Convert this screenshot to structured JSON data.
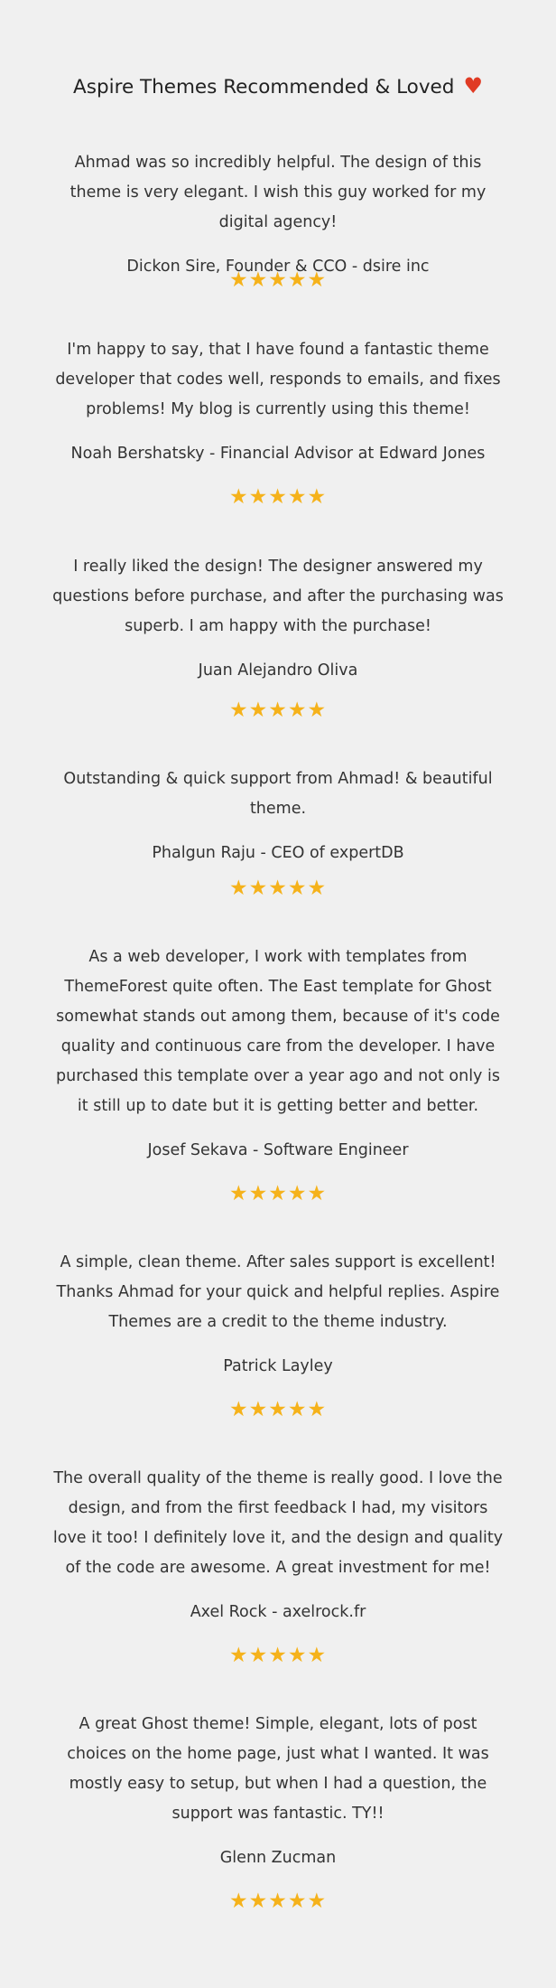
{
  "heading": {
    "title": "Aspire Themes Recommended & Loved",
    "heart_icon": "♥"
  },
  "colors": {
    "background": "#f0f0f0",
    "text": "#333333",
    "heart": "#e03b24",
    "star": "#f5b21b"
  },
  "star_icon": "★",
  "reviews": [
    {
      "quote": "Ahmad was so incredibly helpful. The design of this theme is very elegant. I wish this guy worked for my digital agency!",
      "author": "Dickon Sire, Founder & CCO - dsire inc",
      "rating": 5
    },
    {
      "quote": "I'm happy to say, that I have found a fantastic theme developer that codes well, responds to emails, and fixes problems! My blog is currently using this theme!",
      "author": "Noah Bershatsky - Financial Advisor at Edward Jones",
      "rating": 5
    },
    {
      "quote": "I really liked the design! The designer answered my questions before purchase, and after the purchasing was superb. I am happy with the purchase!",
      "author": "Juan Alejandro Oliva",
      "rating": 5
    },
    {
      "quote": "Outstanding & quick support from Ahmad! & beautiful theme.",
      "author": "Phalgun Raju - CEO of expertDB",
      "rating": 5
    },
    {
      "quote": "As a web developer, I work with templates from ThemeForest quite often. The East template for Ghost somewhat stands out among them, because of it's code quality and continuous care from the developer. I have purchased this template over a year ago and not only is it still up to date but it is getting better and better.",
      "author": "Josef Sekava - Software Engineer",
      "rating": 5
    },
    {
      "quote": "A simple, clean theme. After sales support is excellent! Thanks Ahmad for your quick and helpful replies. Aspire Themes are a credit to the theme industry.",
      "author": "Patrick Layley",
      "rating": 5
    },
    {
      "quote": "The overall quality of the theme is really good. I love the design, and from the first feedback I had, my visitors love it too! I definitely love it, and the design and quality of the code are awesome. A great investment for me!",
      "author": "Axel Rock - axelrock.fr",
      "rating": 5
    },
    {
      "quote": "A great Ghost theme! Simple, elegant, lots of post choices on the home page, just what I wanted. It was mostly easy to setup, but when I had a question, the support was fantastic. TY!!",
      "author": "Glenn Zucman",
      "rating": 5
    }
  ]
}
